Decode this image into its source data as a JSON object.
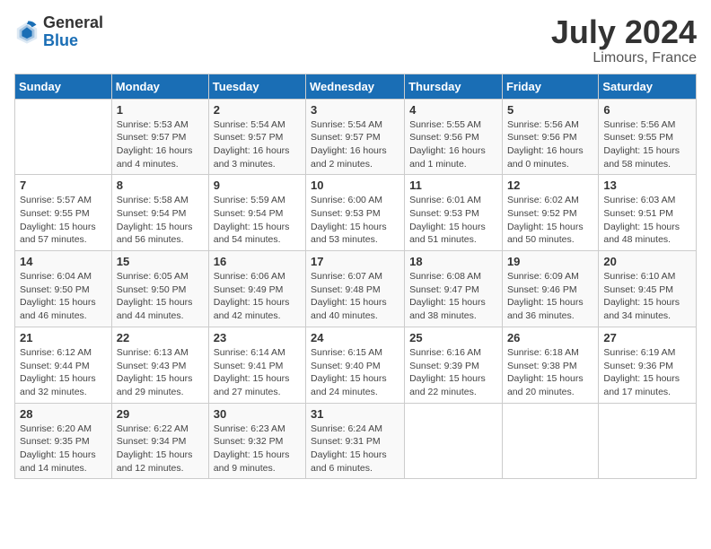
{
  "logo": {
    "general": "General",
    "blue": "Blue"
  },
  "title": {
    "month_year": "July 2024",
    "location": "Limours, France"
  },
  "headers": [
    "Sunday",
    "Monday",
    "Tuesday",
    "Wednesday",
    "Thursday",
    "Friday",
    "Saturday"
  ],
  "weeks": [
    [
      {
        "day": "",
        "detail": ""
      },
      {
        "day": "1",
        "detail": "Sunrise: 5:53 AM\nSunset: 9:57 PM\nDaylight: 16 hours\nand 4 minutes."
      },
      {
        "day": "2",
        "detail": "Sunrise: 5:54 AM\nSunset: 9:57 PM\nDaylight: 16 hours\nand 3 minutes."
      },
      {
        "day": "3",
        "detail": "Sunrise: 5:54 AM\nSunset: 9:57 PM\nDaylight: 16 hours\nand 2 minutes."
      },
      {
        "day": "4",
        "detail": "Sunrise: 5:55 AM\nSunset: 9:56 PM\nDaylight: 16 hours\nand 1 minute."
      },
      {
        "day": "5",
        "detail": "Sunrise: 5:56 AM\nSunset: 9:56 PM\nDaylight: 16 hours\nand 0 minutes."
      },
      {
        "day": "6",
        "detail": "Sunrise: 5:56 AM\nSunset: 9:55 PM\nDaylight: 15 hours\nand 58 minutes."
      }
    ],
    [
      {
        "day": "7",
        "detail": "Sunrise: 5:57 AM\nSunset: 9:55 PM\nDaylight: 15 hours\nand 57 minutes."
      },
      {
        "day": "8",
        "detail": "Sunrise: 5:58 AM\nSunset: 9:54 PM\nDaylight: 15 hours\nand 56 minutes."
      },
      {
        "day": "9",
        "detail": "Sunrise: 5:59 AM\nSunset: 9:54 PM\nDaylight: 15 hours\nand 54 minutes."
      },
      {
        "day": "10",
        "detail": "Sunrise: 6:00 AM\nSunset: 9:53 PM\nDaylight: 15 hours\nand 53 minutes."
      },
      {
        "day": "11",
        "detail": "Sunrise: 6:01 AM\nSunset: 9:53 PM\nDaylight: 15 hours\nand 51 minutes."
      },
      {
        "day": "12",
        "detail": "Sunrise: 6:02 AM\nSunset: 9:52 PM\nDaylight: 15 hours\nand 50 minutes."
      },
      {
        "day": "13",
        "detail": "Sunrise: 6:03 AM\nSunset: 9:51 PM\nDaylight: 15 hours\nand 48 minutes."
      }
    ],
    [
      {
        "day": "14",
        "detail": "Sunrise: 6:04 AM\nSunset: 9:50 PM\nDaylight: 15 hours\nand 46 minutes."
      },
      {
        "day": "15",
        "detail": "Sunrise: 6:05 AM\nSunset: 9:50 PM\nDaylight: 15 hours\nand 44 minutes."
      },
      {
        "day": "16",
        "detail": "Sunrise: 6:06 AM\nSunset: 9:49 PM\nDaylight: 15 hours\nand 42 minutes."
      },
      {
        "day": "17",
        "detail": "Sunrise: 6:07 AM\nSunset: 9:48 PM\nDaylight: 15 hours\nand 40 minutes."
      },
      {
        "day": "18",
        "detail": "Sunrise: 6:08 AM\nSunset: 9:47 PM\nDaylight: 15 hours\nand 38 minutes."
      },
      {
        "day": "19",
        "detail": "Sunrise: 6:09 AM\nSunset: 9:46 PM\nDaylight: 15 hours\nand 36 minutes."
      },
      {
        "day": "20",
        "detail": "Sunrise: 6:10 AM\nSunset: 9:45 PM\nDaylight: 15 hours\nand 34 minutes."
      }
    ],
    [
      {
        "day": "21",
        "detail": "Sunrise: 6:12 AM\nSunset: 9:44 PM\nDaylight: 15 hours\nand 32 minutes."
      },
      {
        "day": "22",
        "detail": "Sunrise: 6:13 AM\nSunset: 9:43 PM\nDaylight: 15 hours\nand 29 minutes."
      },
      {
        "day": "23",
        "detail": "Sunrise: 6:14 AM\nSunset: 9:41 PM\nDaylight: 15 hours\nand 27 minutes."
      },
      {
        "day": "24",
        "detail": "Sunrise: 6:15 AM\nSunset: 9:40 PM\nDaylight: 15 hours\nand 24 minutes."
      },
      {
        "day": "25",
        "detail": "Sunrise: 6:16 AM\nSunset: 9:39 PM\nDaylight: 15 hours\nand 22 minutes."
      },
      {
        "day": "26",
        "detail": "Sunrise: 6:18 AM\nSunset: 9:38 PM\nDaylight: 15 hours\nand 20 minutes."
      },
      {
        "day": "27",
        "detail": "Sunrise: 6:19 AM\nSunset: 9:36 PM\nDaylight: 15 hours\nand 17 minutes."
      }
    ],
    [
      {
        "day": "28",
        "detail": "Sunrise: 6:20 AM\nSunset: 9:35 PM\nDaylight: 15 hours\nand 14 minutes."
      },
      {
        "day": "29",
        "detail": "Sunrise: 6:22 AM\nSunset: 9:34 PM\nDaylight: 15 hours\nand 12 minutes."
      },
      {
        "day": "30",
        "detail": "Sunrise: 6:23 AM\nSunset: 9:32 PM\nDaylight: 15 hours\nand 9 minutes."
      },
      {
        "day": "31",
        "detail": "Sunrise: 6:24 AM\nSunset: 9:31 PM\nDaylight: 15 hours\nand 6 minutes."
      },
      {
        "day": "",
        "detail": ""
      },
      {
        "day": "",
        "detail": ""
      },
      {
        "day": "",
        "detail": ""
      }
    ]
  ]
}
